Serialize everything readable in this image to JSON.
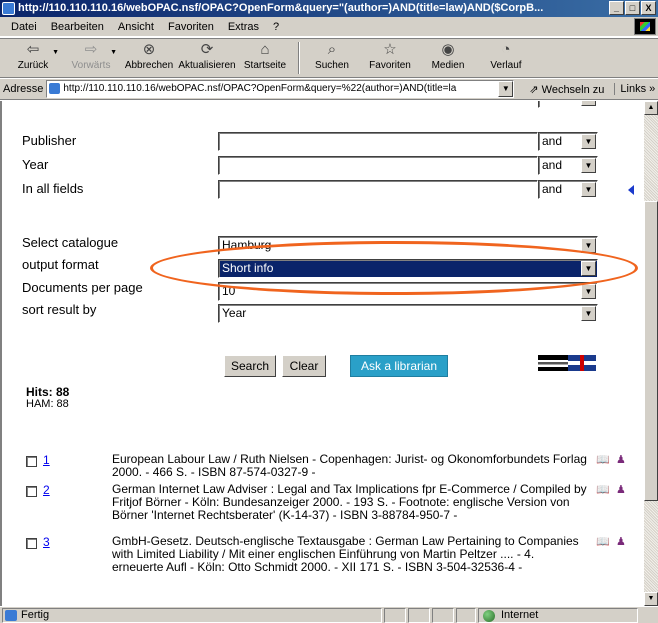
{
  "window": {
    "title": "http://110.110.110.16/webOPAC.nsf/OPAC?OpenForm&query=\"(author=)AND(title=law)AND($CorpB...",
    "controls": [
      "_",
      "□",
      "X"
    ]
  },
  "menu": {
    "items": [
      "Datei",
      "Bearbeiten",
      "Ansicht",
      "Favoriten",
      "Extras",
      "?"
    ]
  },
  "toolbar": {
    "buttons": [
      {
        "label": "Zurück",
        "icon": "back-arrow-icon",
        "glyph": "⇦"
      },
      {
        "label": "Vorwärts",
        "icon": "forward-arrow-icon",
        "glyph": "⇨"
      },
      {
        "label": "Abbrechen",
        "icon": "stop-icon",
        "glyph": "⊗"
      },
      {
        "label": "Aktualisieren",
        "icon": "refresh-icon",
        "glyph": "⟳"
      },
      {
        "label": "Startseite",
        "icon": "home-icon",
        "glyph": "⌂"
      },
      {
        "label": "Suchen",
        "icon": "search-icon",
        "glyph": "⌕"
      },
      {
        "label": "Favoriten",
        "icon": "favorites-icon",
        "glyph": "☆"
      },
      {
        "label": "Medien",
        "icon": "media-icon",
        "glyph": "◉"
      },
      {
        "label": "Verlauf",
        "icon": "history-icon",
        "glyph": "◔"
      }
    ]
  },
  "address": {
    "label": "Adresse",
    "url": "http://110.110.110.16/webOPAC.nsf/OPAC?OpenForm&query=%22(author=)AND(title=la",
    "go_label": "Wechseln zu",
    "links_label": "Links »"
  },
  "form": {
    "fields": [
      {
        "label": "Publisher",
        "operator": "and"
      },
      {
        "label": "Year",
        "operator": "and"
      },
      {
        "label": "In all fields",
        "operator": "and"
      }
    ],
    "options": [
      {
        "label": "Select catalogue",
        "value": "Hamburg"
      },
      {
        "label": "output format",
        "value": "Short info"
      },
      {
        "label": "Documents per page",
        "value": "10"
      },
      {
        "label": "sort result by",
        "value": "Year"
      }
    ],
    "buttons": {
      "search": "Search",
      "clear": "Clear",
      "ask": "Ask a librarian"
    }
  },
  "hits": {
    "title": "Hits: 88",
    "sub": "HAM: 88"
  },
  "results": [
    {
      "num": "1",
      "text": "European Labour Law / Ruth Nielsen - Copenhagen: Jurist- og Okonomforbundets Forlag 2000. - 466 S. - ISBN 87-574-0327-9 -"
    },
    {
      "num": "2",
      "text": "German Internet Law Adviser : Legal and Tax Implications fpr E-Commerce / Compiled by Fritjof Börner - Köln: Bundesanzeiger 2000. - 193 S. - Footnote: englische Version von Börner 'Internet Rechtsberater' (K-14-37) - ISBN 3-88784-950-7 -"
    },
    {
      "num": "3",
      "text": "GmbH-Gesetz. Deutsch-englische Textausgabe : German Law Pertaining to Companies with Limited Liability / Mit einer englischen Einführung von Martin Peltzer .... - 4. erneuerte Aufl - Köln: Otto Schmidt 2000. - XII 171 S. - ISBN 3-504-32536-4 -"
    }
  ],
  "status": {
    "left": "Fertig",
    "zone": "Internet"
  },
  "colors": {
    "titlebar": "#0a246a",
    "highlight": "#0a246a",
    "annotation_oval": "#f0641e",
    "ask_button": "#2aa0c8"
  }
}
